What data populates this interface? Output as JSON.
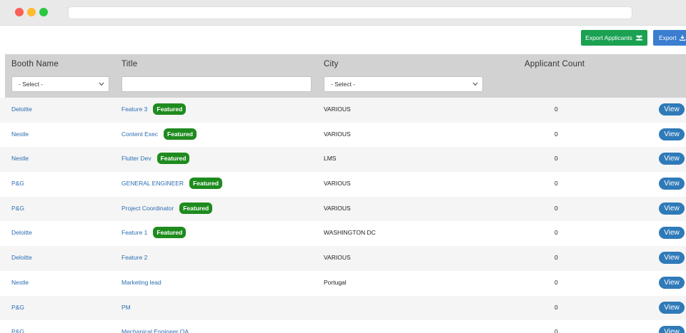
{
  "toolbar": {
    "export_applicants_label": "Export Applicants",
    "export_label": "Export"
  },
  "table": {
    "headers": {
      "booth": "Booth Name",
      "title": "Title",
      "city": "City",
      "count": "Applicant Count"
    },
    "filters": {
      "booth_select": "- Select -",
      "title_input": "",
      "city_select": "- Select -"
    },
    "view_label": "View",
    "featured_label": "Featured",
    "rows": [
      {
        "booth": "Deloitte",
        "title": "Feature 3",
        "featured": true,
        "city": "VARIOUS",
        "count": "0"
      },
      {
        "booth": "Nestle",
        "title": "Content Exec",
        "featured": true,
        "city": "VARIOUS",
        "count": "0"
      },
      {
        "booth": "Nestle",
        "title": "Flutter Dev",
        "featured": true,
        "city": "LMS",
        "count": "0"
      },
      {
        "booth": "P&G",
        "title": "GENERAL ENGINEER",
        "featured": true,
        "city": "VARIOUS",
        "count": "0"
      },
      {
        "booth": "P&G",
        "title": "Project Coordinator",
        "featured": true,
        "city": "VARIOUS",
        "count": "0"
      },
      {
        "booth": "Deloitte",
        "title": "Feature 1",
        "featured": true,
        "city": "WASHINGTON DC",
        "count": "0"
      },
      {
        "booth": "Deloitte",
        "title": "Feature 2",
        "featured": false,
        "city": "VARIOUS",
        "count": "0"
      },
      {
        "booth": "Nestle",
        "title": "Marketing lead",
        "featured": false,
        "city": "Portugal",
        "count": "0"
      },
      {
        "booth": "P&G",
        "title": "PM",
        "featured": false,
        "city": "",
        "count": "0"
      },
      {
        "booth": "P&G",
        "title": "Mechanical Engineer QA",
        "featured": false,
        "city": "",
        "count": "0"
      }
    ]
  },
  "colors": {
    "export_applicants_bg": "#1aa152",
    "export_bg": "#3b7ed0",
    "link": "#2b6db3",
    "featured_badge": "#1e8b1e",
    "view_button": "#2f7ab8",
    "header_bg": "#d2d2d2"
  }
}
